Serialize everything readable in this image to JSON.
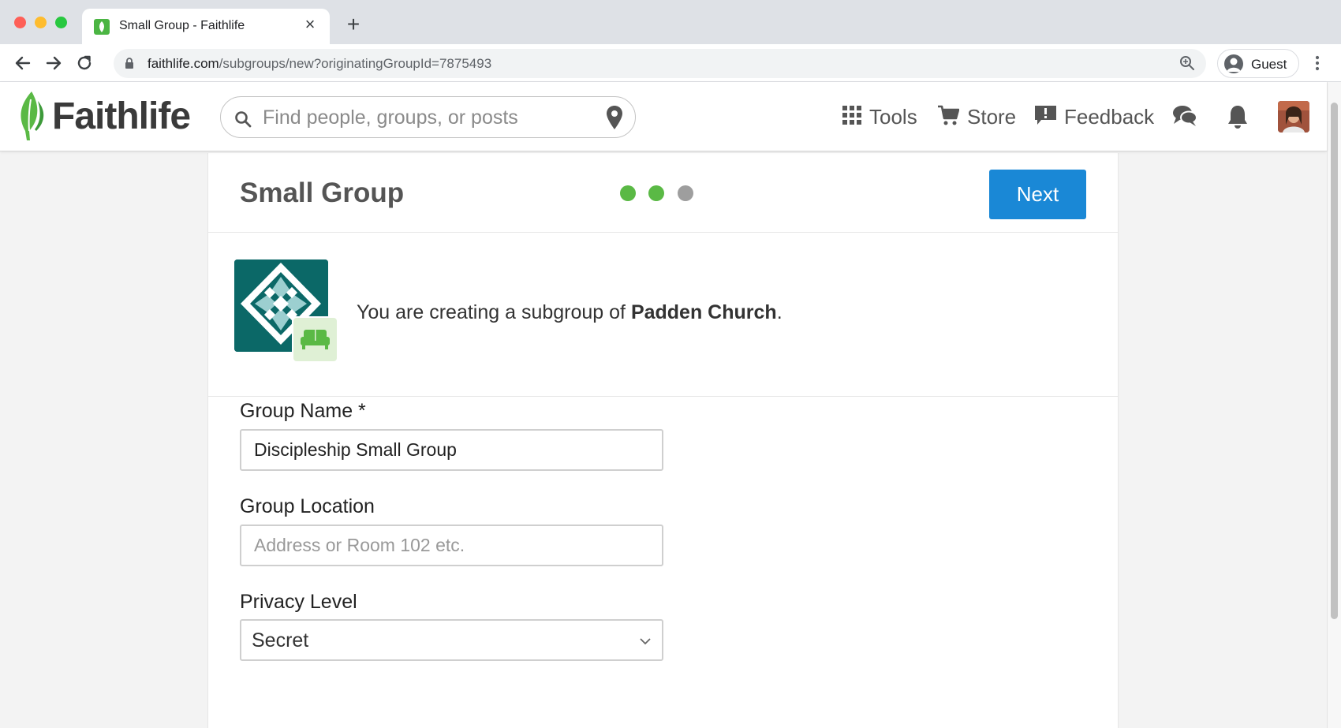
{
  "browser": {
    "tab_title": "Small Group - Faithlife",
    "url_host": "faithlife.com",
    "url_path": "/subgroups/new?originatingGroupId=7875493",
    "profile_label": "Guest"
  },
  "header": {
    "logo_text": "Faithlife",
    "search_placeholder": "Find people, groups, or posts",
    "nav": {
      "tools": "Tools",
      "store": "Store",
      "feedback": "Feedback"
    },
    "icons": [
      "tools-grid-icon",
      "cart-icon",
      "feedback-icon",
      "chat-icon",
      "bell-icon"
    ]
  },
  "page": {
    "title": "Small Group",
    "steps": {
      "total": 3,
      "completed": 2,
      "active_color": "#5ab945",
      "inactive_color": "#9e9e9e"
    },
    "next_label": "Next",
    "parent_prefix": "You are creating a subgroup of ",
    "parent_name": "Padden Church",
    "parent_suffix": "."
  },
  "form": {
    "group_name_label": "Group Name *",
    "group_name_value": "Discipleship Small Group",
    "group_location_label": "Group Location",
    "group_location_placeholder": "Address or Room 102 etc.",
    "privacy_label": "Privacy Level",
    "privacy_value": "Secret"
  },
  "colors": {
    "accent": "#1a88d6",
    "brand_green": "#4bb543",
    "group_logo_bg": "#0b6867"
  }
}
